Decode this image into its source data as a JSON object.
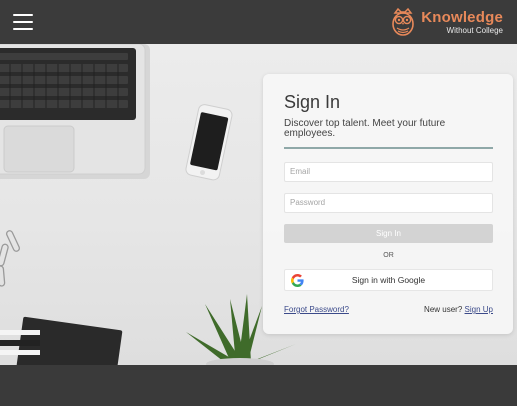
{
  "header": {
    "menu_icon": "hamburger-icon",
    "logo_title": "Knowledge",
    "logo_subtitle": "Without College",
    "logo_icon": "owl-icon"
  },
  "signin": {
    "title": "Sign In",
    "description": "Discover top talent. Meet your future employees.",
    "email_placeholder": "Email",
    "password_placeholder": "Password",
    "submit_label": "Sign In",
    "or_label": "OR",
    "google_label": "Sign in with Google",
    "google_icon": "google-icon",
    "forgot_label": "Forgot Password?",
    "new_user_label": "New user?",
    "signup_label": "Sign Up"
  },
  "colors": {
    "brand": "#e8895a",
    "topbar": "#3b3b3b",
    "link": "#3b4a8a"
  }
}
